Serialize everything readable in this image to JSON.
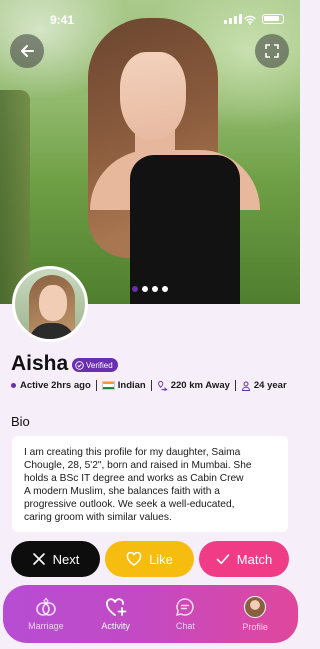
{
  "status_bar": {
    "time": "9:41"
  },
  "profile": {
    "name": "Aisha",
    "verified_label": "Verified",
    "active": "Active 2hrs ago",
    "nationality": "Indian",
    "distance": "220 km Away",
    "age": "24 year",
    "photo_count": 4,
    "current_photo_index": 0
  },
  "bio": {
    "title": "Bio",
    "lines": [
      "I am creating this profile for my daughter, Saima",
      "Chougle, 28, 5'2\", born and raised in Mumbai. She",
      "holds a BSc IT degree and works as Cabin Crew",
      "A modern Muslim, she balances faith with a",
      "progressive outlook. We seek a well-educated,",
      "caring groom with similar values."
    ]
  },
  "actions": {
    "next": "Next",
    "like": "Like",
    "match": "Match"
  },
  "tabbar": {
    "marriage": "Marriage",
    "activity": "Activity",
    "chat": "Chat",
    "profile": "Profile"
  },
  "colors": {
    "accent_purple": "#6a2fb0",
    "like_yellow": "#f6bd10",
    "match_pink": "#f03c86",
    "tabbar_gradient": [
      "#b64dd3",
      "#e0479c"
    ]
  },
  "icons": [
    "back-arrow-icon",
    "expand-icon",
    "verified-icon",
    "india-flag-icon",
    "location-distance-icon",
    "person-icon",
    "close-icon",
    "heart-icon",
    "check-icon",
    "rings-icon",
    "heart-plus-icon",
    "chat-bubble-icon"
  ]
}
